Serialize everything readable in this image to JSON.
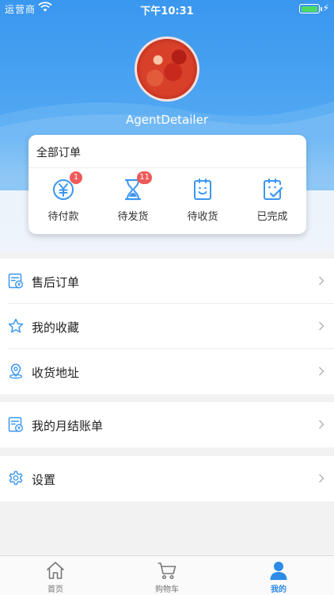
{
  "status_bar": {
    "carrier": "运营商",
    "time": "下午10:31"
  },
  "profile": {
    "username": "AgentDetailer"
  },
  "orders": {
    "title": "全部订单",
    "items": [
      {
        "label": "待付款",
        "icon": "yen-coin-icon",
        "badge": "1"
      },
      {
        "label": "待发货",
        "icon": "hourglass-icon",
        "badge": "11"
      },
      {
        "label": "待收货",
        "icon": "smile-clipboard-icon",
        "badge": ""
      },
      {
        "label": "已完成",
        "icon": "check-clipboard-icon",
        "badge": ""
      }
    ]
  },
  "menu": {
    "group1": [
      {
        "label": "售后订单",
        "icon": "receipt-icon"
      },
      {
        "label": "我的收藏",
        "icon": "star-icon"
      },
      {
        "label": "收货地址",
        "icon": "location-pin-icon"
      }
    ],
    "group2": [
      {
        "label": "我的月结账单",
        "icon": "bill-icon"
      }
    ],
    "group3": [
      {
        "label": "设置",
        "icon": "gear-icon"
      }
    ]
  },
  "tabbar": {
    "tabs": [
      {
        "label": "首页",
        "icon": "home-icon",
        "active": false
      },
      {
        "label": "购物车",
        "icon": "cart-icon",
        "active": false
      },
      {
        "label": "我的",
        "icon": "user-icon",
        "active": true
      }
    ]
  },
  "colors": {
    "primary": "#3a97ef",
    "badge": "#ef5a5a",
    "icon": "#3a97ef",
    "active_tab": "#2c8be5"
  }
}
